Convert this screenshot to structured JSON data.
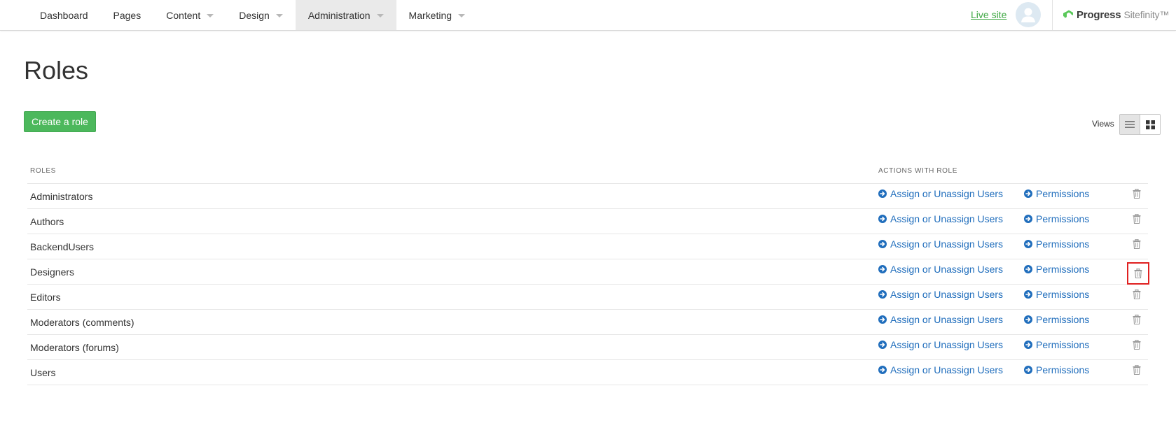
{
  "nav": {
    "items": [
      {
        "label": "Dashboard",
        "dropdown": false
      },
      {
        "label": "Pages",
        "dropdown": false
      },
      {
        "label": "Content",
        "dropdown": true
      },
      {
        "label": "Design",
        "dropdown": true
      },
      {
        "label": "Administration",
        "dropdown": true,
        "active": true
      },
      {
        "label": "Marketing",
        "dropdown": true
      }
    ],
    "live_site": "Live site",
    "brand": {
      "main": "Progress",
      "sub": "Sitefinity™"
    }
  },
  "page": {
    "title": "Roles",
    "create_button": "Create a role",
    "views_label": "Views"
  },
  "table": {
    "columns": {
      "roles": "ROLES",
      "actions": "ACTIONS WITH ROLE"
    },
    "action_labels": {
      "assign": "Assign or Unassign Users",
      "permissions": "Permissions"
    },
    "rows": [
      {
        "name": "Administrators"
      },
      {
        "name": "Authors"
      },
      {
        "name": "BackendUsers"
      },
      {
        "name": "Designers",
        "delete_highlighted": true
      },
      {
        "name": "Editors"
      },
      {
        "name": "Moderators (comments)"
      },
      {
        "name": "Moderators (forums)"
      },
      {
        "name": "Users"
      }
    ]
  },
  "colors": {
    "accent_green": "#4cb85c",
    "link_blue": "#1f6dbc",
    "live_site_green": "#3fa844",
    "highlight_red": "#e02020"
  },
  "icons": {
    "avatar": "user-avatar-icon",
    "brand": "progress-logo-icon",
    "list_view": "list-view-icon",
    "grid_view": "grid-view-icon",
    "action": "circle-arrow-right-icon",
    "delete": "trash-icon"
  }
}
